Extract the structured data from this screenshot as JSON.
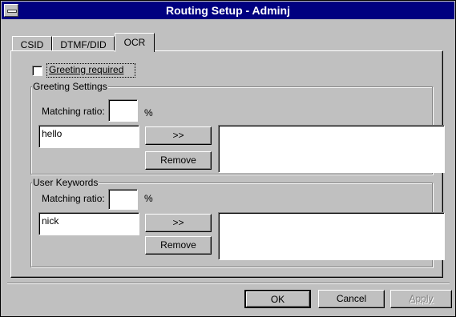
{
  "window": {
    "title": "Routing Setup - Adminj"
  },
  "tabs": [
    {
      "label": "CSID",
      "active": false
    },
    {
      "label": "DTMF/DID",
      "active": false
    },
    {
      "label": "OCR",
      "active": true
    }
  ],
  "ocr": {
    "greeting_required": {
      "label": "Greeting required",
      "checked": false
    },
    "greeting_settings": {
      "title": "Greeting Settings",
      "matching_ratio_label": "Matching ratio:",
      "matching_ratio_value": "",
      "percent": "%",
      "keyword_value": "hello",
      "add_label": ">>",
      "remove_label": "Remove",
      "list_items": []
    },
    "user_keywords": {
      "title": "User Keywords",
      "matching_ratio_label": "Matching ratio:",
      "matching_ratio_value": "",
      "percent": "%",
      "keyword_value": "nick",
      "add_label": ">>",
      "remove_label": "Remove",
      "list_items": []
    }
  },
  "footer": {
    "ok_label": "OK",
    "cancel_label": "Cancel",
    "apply_label": "Apply",
    "apply_enabled": false
  }
}
